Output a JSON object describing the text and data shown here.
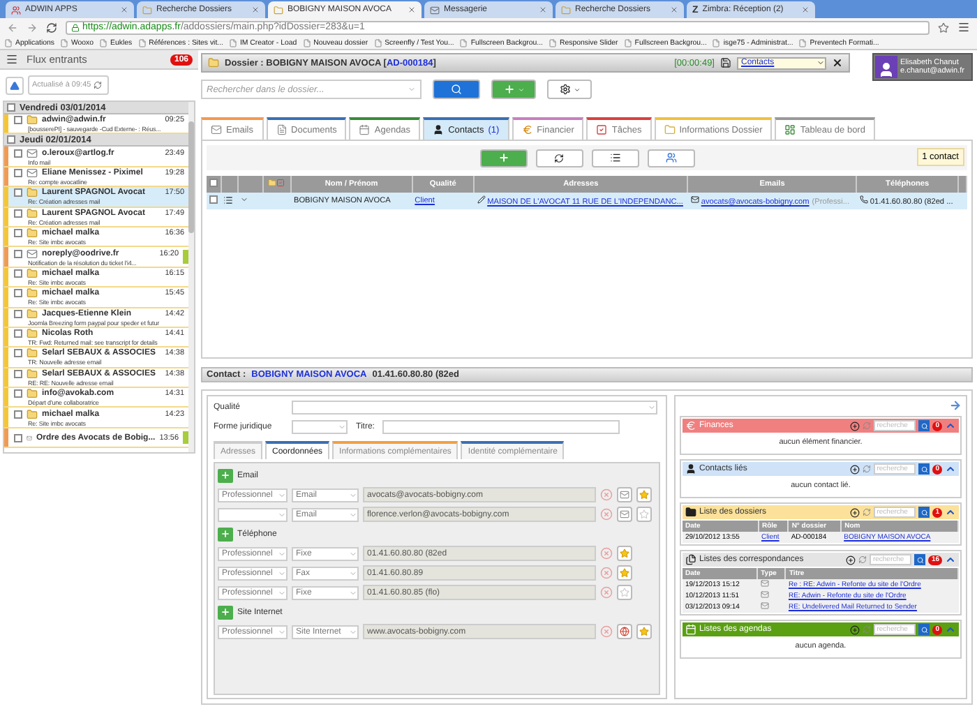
{
  "browser": {
    "tabs": [
      {
        "title": "ADWIN APPS",
        "selected": false,
        "kind": "app"
      },
      {
        "title": "Recherche Dossiers",
        "selected": false,
        "kind": "folder"
      },
      {
        "title": "BOBIGNY MAISON AVOCA",
        "selected": true,
        "kind": "folder"
      },
      {
        "title": "Messagerie",
        "selected": false,
        "kind": "mail"
      },
      {
        "title": "Recherche Dossiers",
        "selected": false,
        "kind": "folder"
      },
      {
        "title": "Zimbra: Réception (2)",
        "selected": false,
        "kind": "letter",
        "glyph": "Z"
      }
    ],
    "url": {
      "host": "https://adwin.adapps.fr",
      "path": "/addossiers/main.php?idDossier=283&u=1"
    },
    "bookmarks": [
      "Applications",
      "Wooxo",
      "Eukles",
      "Références : Sites vit...",
      "IM Creator - Load",
      "Nouveau dossier",
      "Screenfly / Test You...",
      "Fullscreen Backgrou...",
      "Responsive Slider",
      "Fullscreen Backgrou...",
      "isge75 - Administrat...",
      "Preventech Formati..."
    ]
  },
  "sidebar": {
    "title": "Flux entrants",
    "badge": "106",
    "refresh_label": "Actualisé à 09:45",
    "groups": [
      {
        "date": "Vendredi 03/01/2014",
        "checked": false,
        "items": [
          {
            "kind": "folder",
            "sender": "adwin@adwin.fr",
            "time": "09:25",
            "subject": "[bousserePI] - sauvegarde -Cud Externe- : Réus...",
            "color": "#f7c62f",
            "selected": false,
            "flagged": false
          }
        ]
      },
      {
        "date": "Jeudi 02/01/2014",
        "checked": false,
        "items": [
          {
            "kind": "mail",
            "sender": "o.leroux@artlog.fr",
            "time": "23:49",
            "subject": "Info mail",
            "color": "#f29a4f",
            "selected": false,
            "flagged": false
          },
          {
            "kind": "mail",
            "sender": "Eliane Menissez - Piximel",
            "time": "19:28",
            "subject": "Re: compte avocatline",
            "color": "#f29a4f",
            "selected": false,
            "flagged": false
          },
          {
            "kind": "folder",
            "sender": "Laurent SPAGNOL Avocat",
            "time": "17:50",
            "subject": "Re: Création adresses mail",
            "color": "#f7c62f",
            "selected": true,
            "flagged": false
          },
          {
            "kind": "folder",
            "sender": "Laurent SPAGNOL Avocat",
            "time": "17:49",
            "subject": "Re: Création adresses mail",
            "color": "#f7c62f",
            "selected": false,
            "flagged": false
          },
          {
            "kind": "folder",
            "sender": "michael malka",
            "time": "16:36",
            "subject": "Re: Site imbc avocats",
            "color": "#f7c62f",
            "selected": false,
            "flagged": false
          },
          {
            "kind": "mail",
            "sender": "noreply@oodrive.fr",
            "time": "16:20",
            "subject": "Notification de la résolution du ticket l'i4...",
            "color": "#f29a4f",
            "selected": false,
            "flagged": true
          },
          {
            "kind": "folder",
            "sender": "michael malka",
            "time": "16:15",
            "subject": "Re: Site imbc avocats",
            "color": "#f7c62f",
            "selected": false,
            "flagged": false
          },
          {
            "kind": "folder",
            "sender": "michael malka",
            "time": "15:45",
            "subject": "Re: Site imbc avocats",
            "color": "#f7c62f",
            "selected": false,
            "flagged": false
          },
          {
            "kind": "folder",
            "sender": "Jacques-Etienne Klein",
            "time": "14:42",
            "subject": "Joomla Breezing form paypal pour speder et futur",
            "color": "#f7c62f",
            "selected": false,
            "flagged": false
          },
          {
            "kind": "folder",
            "sender": "Nicolas Roth",
            "time": "14:41",
            "subject": "TR: Fwd: Returned mail: see transcript for details",
            "color": "#f7c62f",
            "selected": false,
            "flagged": false
          },
          {
            "kind": "folder",
            "sender": "Selarl SEBAUX & ASSOCIES",
            "time": "14:38",
            "subject": "TR: Nouvelle adresse email",
            "color": "#f7c62f",
            "selected": false,
            "flagged": false
          },
          {
            "kind": "folder",
            "sender": "Selarl SEBAUX & ASSOCIES",
            "time": "14:38",
            "subject": "RE: RE: Nouvelle adresse email",
            "color": "#f7c62f",
            "selected": false,
            "flagged": false
          },
          {
            "kind": "folder",
            "sender": "info@avokab.com",
            "time": "14:31",
            "subject": "Départ d'une collaboratrice",
            "color": "#f7c62f",
            "selected": false,
            "flagged": false
          },
          {
            "kind": "folder",
            "sender": "michael malka",
            "time": "14:23",
            "subject": "Re: Site imbc avocats",
            "color": "#f7c62f",
            "selected": false,
            "flagged": false
          },
          {
            "kind": "mail",
            "sender": "Ordre des Avocats de Bobig...",
            "time": "13:56",
            "color": "#f29a4f",
            "selected": false,
            "flagged": true
          }
        ]
      }
    ]
  },
  "header": {
    "dossier_label": "Dossier : BOBIGNY MAISON AVOCA [",
    "dossier_id": "AD-000184",
    "dossier_close": "]",
    "timer": "[00:00:49]",
    "view_select": "Contacts",
    "user_name": "Elisabeth Chanut",
    "user_email": "e.chanut@adwin.fr",
    "search_placeholder": "Rechercher dans le dossier..."
  },
  "tabs": [
    {
      "label": "Emails",
      "kind": "mail",
      "color": "#f29a4f",
      "selected": false
    },
    {
      "label": "Documents",
      "kind": "doc",
      "color": "#3b6fb3",
      "selected": false
    },
    {
      "label": "Agendas",
      "kind": "calendar",
      "color": "#3a8a3a",
      "selected": false
    },
    {
      "label": "Contacts",
      "count": "(1)",
      "kind": "contact",
      "color": "#3b6fb3",
      "selected": true
    },
    {
      "label": "Financier",
      "kind": "money",
      "color": "#c77fc0",
      "selected": false
    },
    {
      "label": "Tâches",
      "kind": "task",
      "color": "#d94040",
      "selected": false
    },
    {
      "label": "Informations Dossier",
      "kind": "folder",
      "color": "#f0c040",
      "selected": false
    },
    {
      "label": "Tableau de bord",
      "kind": "dashboard",
      "color": "#999999",
      "selected": false
    }
  ],
  "contacts_table": {
    "count": "1 contact",
    "all_checked": false,
    "columns": [
      "Nom / Prénom",
      "Qualité",
      "Adresses",
      "Emails",
      "Téléphones"
    ],
    "rows": [
      {
        "checked": false,
        "name": "BOBIGNY MAISON AVOCA",
        "qualite": "Client",
        "address": "MAISON DE L'AVOCAT 11 RUE DE L'INDEPENDANC...",
        "email": "avocats@avocats-bobigny.com",
        "email_note": "(Professi...",
        "phone": "01.41.60.80.80 (82ed ..."
      }
    ]
  },
  "contact": {
    "label": "Contact :",
    "name": "BOBIGNY MAISON AVOCA",
    "phone": "01.41.60.80.80 (82ed",
    "form": {
      "qualite_label": "Qualité",
      "forme_label": "Forme juridique",
      "titre_label": "Titre:"
    },
    "subtabs": [
      {
        "label": "Adresses",
        "color": "#cccccc",
        "selected": false
      },
      {
        "label": "Coordonnées",
        "color": "#3b6fb3",
        "selected": true
      },
      {
        "label": "Informations complémentaires",
        "color": "#f0a040",
        "selected": false
      },
      {
        "label": "Identité complémentaire",
        "color": "#3b6fb3",
        "selected": false
      }
    ],
    "sections": [
      {
        "title": "Email",
        "kind": "email",
        "rows": [
          {
            "type": "Professionnel",
            "subtype": "Email",
            "value": "avocats@avocats-bobigny.com",
            "starred": true
          },
          {
            "subtype": "Email",
            "value": "florence.verlon@avocats-bobigny.com",
            "starred": false
          }
        ]
      },
      {
        "title": "Téléphone",
        "kind": "phone",
        "rows": [
          {
            "type": "Professionnel",
            "subtype": "Fixe",
            "value": "01.41.60.80.80 (82ed",
            "starred": true
          },
          {
            "type": "Professionnel",
            "subtype": "Fax",
            "value": "01.41.60.80.89",
            "starred": true
          },
          {
            "type": "Professionnel",
            "subtype": "Fixe",
            "value": "01.41.60.80.85 (flo)",
            "starred": false
          }
        ]
      },
      {
        "title": "Site Internet",
        "kind": "web",
        "rows": [
          {
            "type": "Professionnel",
            "subtype": "Site Internet",
            "value": "www.avocats-bobigny.com",
            "starred": true
          }
        ]
      }
    ]
  },
  "panels": [
    {
      "title": "Finances",
      "kind": "money",
      "color": "#f08080",
      "badge": "0",
      "search_placeholder": "recherche",
      "empty_text": "aucun élément financier."
    },
    {
      "title": "Contacts liés",
      "kind": "contact",
      "color": "#cfe2f7",
      "badge": "0",
      "search_placeholder": "recherche",
      "empty_text": "aucun contact lié."
    },
    {
      "title": "Liste des dossiers",
      "kind": "folder",
      "color": "#fbe19a",
      "badge": "1",
      "search_placeholder": "recherche",
      "table": {
        "columns": [
          "Date",
          "Rôle",
          "N° dossier",
          "Nom"
        ],
        "rows": [
          [
            "29/10/2012 13:55",
            "Client",
            "AD-000184",
            "BOBIGNY MAISON AVOCA"
          ]
        ]
      }
    },
    {
      "title": "Listes des correspondances",
      "kind": "docs",
      "color": "#e4e4e4",
      "badge": "16",
      "search_placeholder": "recherche",
      "table": {
        "columns": [
          "Date",
          "Type",
          "Titre"
        ],
        "rows": [
          [
            "19/12/2013 15:12",
            "",
            "Re : RE: Adwin - Refonte du site de l'Ordre"
          ],
          [
            "10/12/2013 11:51",
            "",
            "RE: Adwin - Refonte du site de l'Ordre"
          ],
          [
            "03/12/2013 09:14",
            "",
            "RE: Undelivered Mail Returned to Sender"
          ]
        ]
      }
    },
    {
      "title": "Listes des agendas",
      "kind": "calendar",
      "color": "#5aa012",
      "badge": "0",
      "search_placeholder": "recherche",
      "empty_text": "aucun agenda."
    }
  ]
}
